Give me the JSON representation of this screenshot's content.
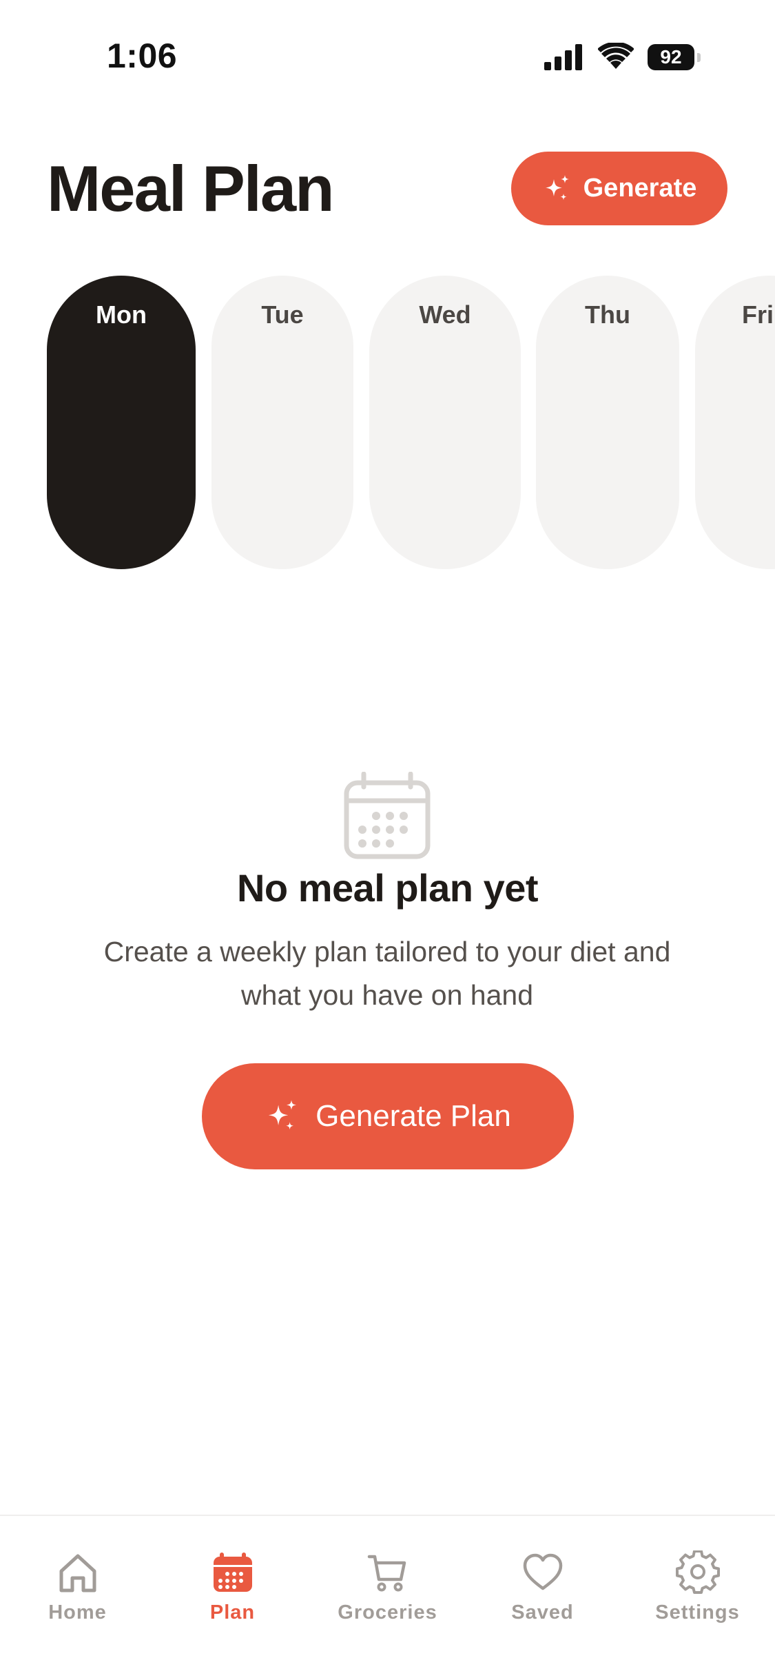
{
  "status_bar": {
    "time": "1:06",
    "battery": "92"
  },
  "header": {
    "title": "Meal Plan",
    "generate_label": "Generate"
  },
  "days": [
    {
      "label": "Mon",
      "active": true
    },
    {
      "label": "Tue",
      "active": false
    },
    {
      "label": "Wed",
      "active": false
    },
    {
      "label": "Thu",
      "active": false
    },
    {
      "label": "Fri",
      "active": false
    }
  ],
  "empty_state": {
    "icon": "calendar-icon",
    "title": "No meal plan yet",
    "description": "Create a weekly plan tailored to your diet and what you have on hand",
    "button_label": "Generate Plan"
  },
  "tab_bar": {
    "items": [
      {
        "label": "Home",
        "icon": "home-icon",
        "active": false
      },
      {
        "label": "Plan",
        "icon": "calendar-icon",
        "active": true
      },
      {
        "label": "Groceries",
        "icon": "cart-icon",
        "active": false
      },
      {
        "label": "Saved",
        "icon": "heart-icon",
        "active": false
      },
      {
        "label": "Settings",
        "icon": "gear-icon",
        "active": false
      }
    ]
  },
  "colors": {
    "accent": "#e95940",
    "active_day": "#1f1b18",
    "inactive_day": "#f4f3f2",
    "muted_text": "#a19c98"
  }
}
